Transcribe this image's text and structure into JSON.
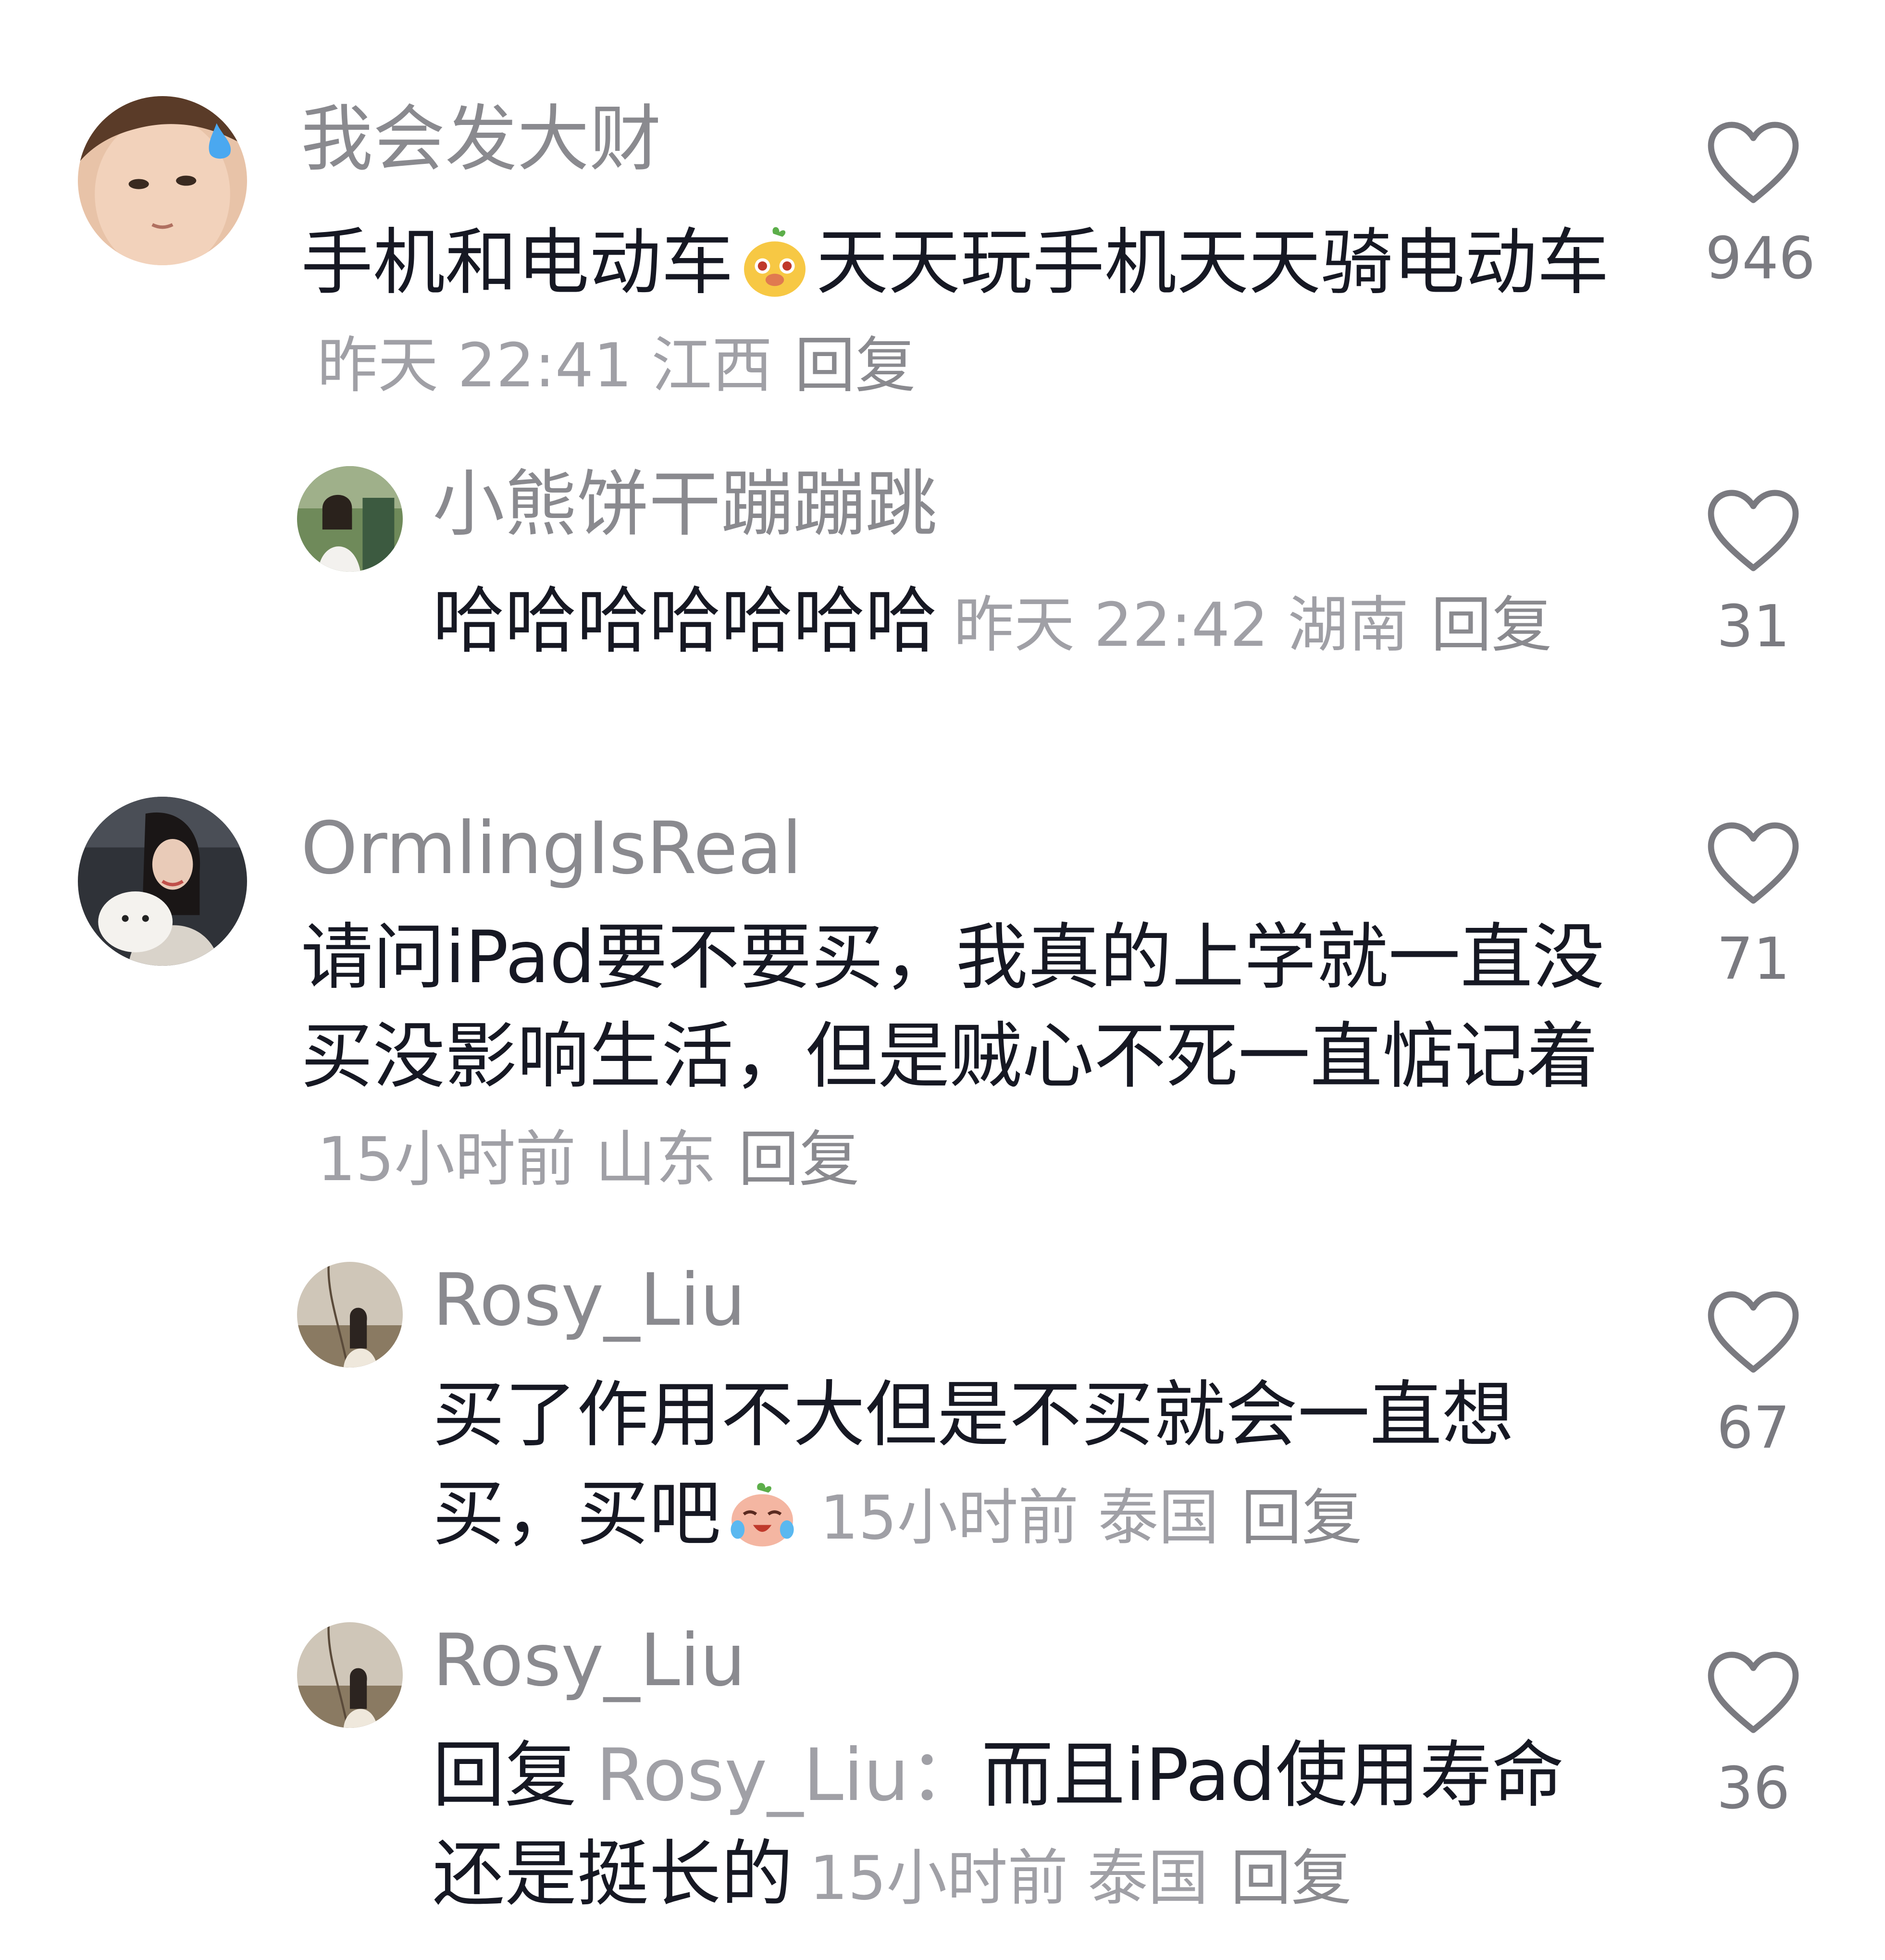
{
  "comments": [
    {
      "username": "我会发大财",
      "text_a": "手机和电动车",
      "emoji_a": "pear-face-emoji",
      "text_b": "天天玩手机天天骑电动车",
      "time": "昨天 22:41",
      "location": "江西",
      "reply_label": "回复",
      "likes": "946"
    },
    {
      "username": "小熊饼干蹦蹦跳",
      "text": "哈哈哈哈哈哈哈",
      "time": "昨天 22:42",
      "location": "湖南",
      "reply_label": "回复",
      "likes": "31"
    },
    {
      "username": "OrmlingIsReal",
      "text": "请问iPad要不要买，我真的上学就一直没买没影响生活，但是贼心不死一直惦记着",
      "time": "15小时前",
      "location": "山东",
      "reply_label": "回复",
      "likes": "71"
    },
    {
      "username": "Rosy_Liu",
      "text": "买了作用不大但是不买就会一直想买，买吧",
      "emoji": "crying-laugh-emoji",
      "time": "15小时前",
      "location": "泰国",
      "reply_label": "回复",
      "likes": "67"
    },
    {
      "username": "Rosy_Liu",
      "reply_prefix": "回复",
      "mention": "Rosy_Liu：",
      "text": "而且iPad使用寿命还是挺长的",
      "time": "15小时前",
      "location": "泰国",
      "reply_label": "回复",
      "likes": "36"
    }
  ],
  "colors": {
    "text": "#161823",
    "username": "#8a8a8f",
    "meta": "#a0a0a6",
    "heart": "#7a7a80"
  }
}
